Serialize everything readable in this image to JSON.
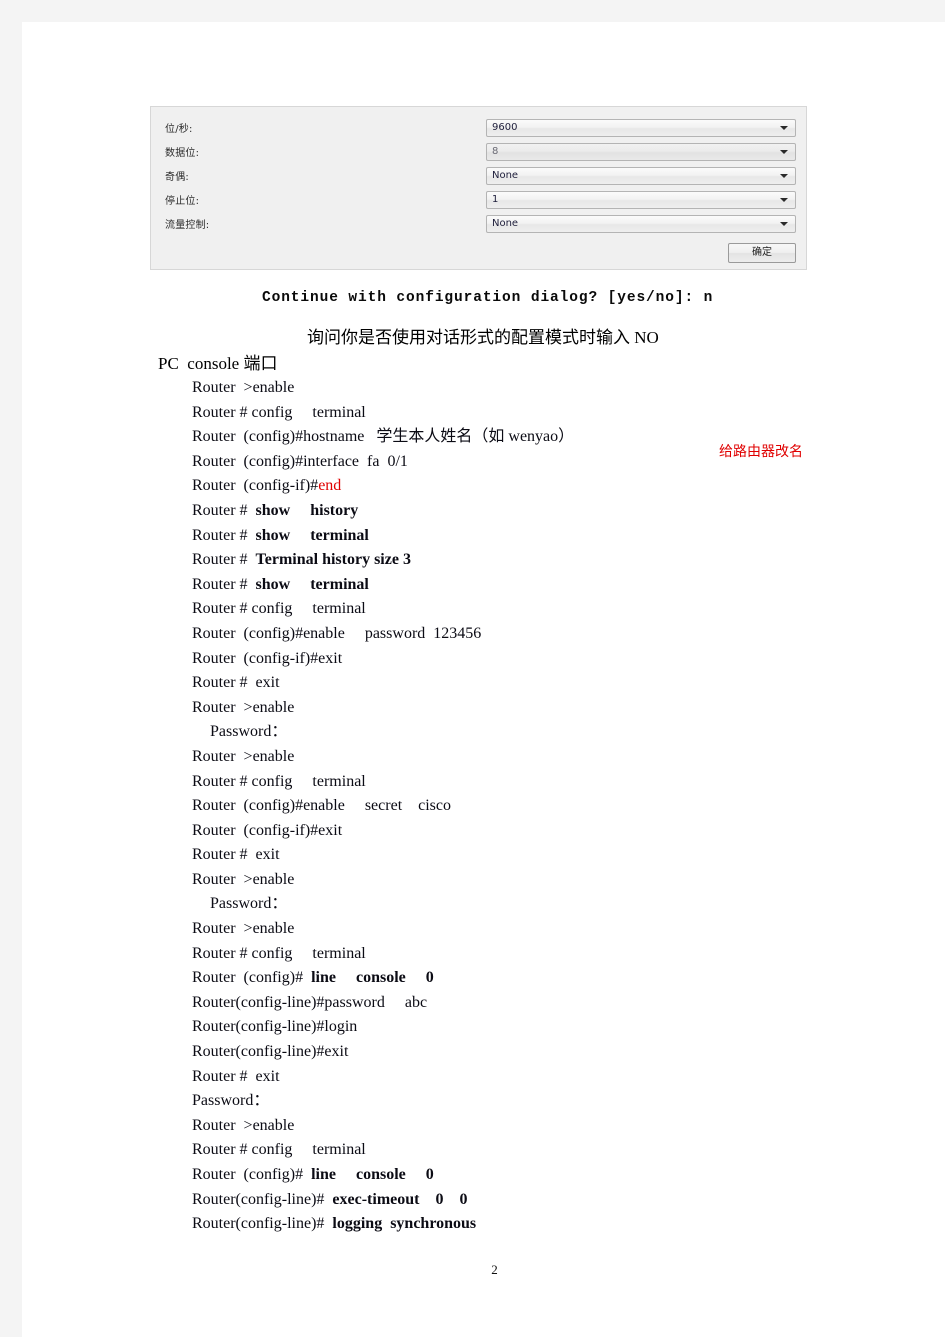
{
  "dialog": {
    "rows": [
      {
        "label": "位/秒:",
        "value": "9600",
        "dim": false
      },
      {
        "label": "数据位:",
        "value": "8",
        "dim": true
      },
      {
        "label": "奇偶:",
        "value": "None",
        "dim": false
      },
      {
        "label": "停止位:",
        "value": "1",
        "dim": false
      },
      {
        "label": "流量控制:",
        "value": "None",
        "dim": false
      }
    ],
    "ok_label": "确定"
  },
  "console_prompt": "Continue with configuration dialog? [yes/no]: n",
  "caption_cn": "询问你是否使用对话形式的配置模式时输入 NO",
  "section_head": "PC  console 端口",
  "red_note": "给路由器改名",
  "page_number": "2",
  "commands": [
    {
      "indent": 0,
      "parts": [
        {
          "t": "Router  >enable",
          "b": false,
          "r": false
        }
      ]
    },
    {
      "indent": 0,
      "parts": [
        {
          "t": "Router # config     terminal",
          "b": false,
          "r": false
        }
      ]
    },
    {
      "indent": 0,
      "parts": [
        {
          "t": "Router  (config)#hostname   学生本人姓名（如 wenyao）",
          "b": false,
          "r": false
        }
      ]
    },
    {
      "indent": 0,
      "parts": [
        {
          "t": "Router  (config)#interface  fa  0/1",
          "b": false,
          "r": false
        }
      ]
    },
    {
      "indent": 0,
      "parts": [
        {
          "t": "Router  (config-if)#",
          "b": false,
          "r": false
        },
        {
          "t": "end",
          "b": false,
          "r": true
        }
      ]
    },
    {
      "indent": 0,
      "parts": [
        {
          "t": "Router #  ",
          "b": false,
          "r": false
        },
        {
          "t": "show     history",
          "b": true,
          "r": false
        }
      ]
    },
    {
      "indent": 0,
      "parts": [
        {
          "t": "Router #  ",
          "b": false,
          "r": false
        },
        {
          "t": "show     terminal",
          "b": true,
          "r": false
        }
      ]
    },
    {
      "indent": 0,
      "parts": [
        {
          "t": "Router #  ",
          "b": false,
          "r": false
        },
        {
          "t": "Terminal history size 3",
          "b": true,
          "r": false
        }
      ]
    },
    {
      "indent": 0,
      "parts": [
        {
          "t": "Router #  ",
          "b": false,
          "r": false
        },
        {
          "t": "show     terminal",
          "b": true,
          "r": false
        }
      ]
    },
    {
      "indent": 0,
      "parts": [
        {
          "t": "Router # config     terminal",
          "b": false,
          "r": false
        }
      ]
    },
    {
      "indent": 0,
      "parts": [
        {
          "t": "Router  (config)#enable     password  123456",
          "b": false,
          "r": false
        }
      ]
    },
    {
      "indent": 0,
      "parts": [
        {
          "t": "Router  (config-if)#exit",
          "b": false,
          "r": false
        }
      ]
    },
    {
      "indent": 0,
      "parts": [
        {
          "t": "Router #  exit",
          "b": false,
          "r": false
        }
      ]
    },
    {
      "indent": 0,
      "parts": [
        {
          "t": "Router  >enable",
          "b": false,
          "r": false
        }
      ]
    },
    {
      "indent": 1,
      "parts": [
        {
          "t": "Password：",
          "b": false,
          "r": false
        }
      ]
    },
    {
      "indent": 0,
      "parts": [
        {
          "t": "Router  >enable",
          "b": false,
          "r": false
        }
      ]
    },
    {
      "indent": 0,
      "parts": [
        {
          "t": "Router # config     terminal",
          "b": false,
          "r": false
        }
      ]
    },
    {
      "indent": 0,
      "parts": [
        {
          "t": "Router  (config)#enable     secret    cisco",
          "b": false,
          "r": false
        }
      ]
    },
    {
      "indent": 0,
      "parts": [
        {
          "t": "Router  (config-if)#exit",
          "b": false,
          "r": false
        }
      ]
    },
    {
      "indent": 0,
      "parts": [
        {
          "t": "Router #  exit",
          "b": false,
          "r": false
        }
      ]
    },
    {
      "indent": 0,
      "parts": [
        {
          "t": "Router  >enable",
          "b": false,
          "r": false
        }
      ]
    },
    {
      "indent": 1,
      "parts": [
        {
          "t": "Password：",
          "b": false,
          "r": false
        }
      ]
    },
    {
      "indent": 0,
      "parts": [
        {
          "t": "Router  >enable",
          "b": false,
          "r": false
        }
      ]
    },
    {
      "indent": 0,
      "parts": [
        {
          "t": "Router # config     terminal",
          "b": false,
          "r": false
        }
      ]
    },
    {
      "indent": 0,
      "parts": [
        {
          "t": "Router  (config)#  ",
          "b": false,
          "r": false
        },
        {
          "t": "line     console     0",
          "b": true,
          "r": false
        }
      ]
    },
    {
      "indent": 0,
      "parts": [
        {
          "t": "Router(config-line)#password     abc",
          "b": false,
          "r": false
        }
      ]
    },
    {
      "indent": 0,
      "parts": [
        {
          "t": "Router(config-line)#login",
          "b": false,
          "r": false
        }
      ]
    },
    {
      "indent": 0,
      "parts": [
        {
          "t": "Router(config-line)#exit",
          "b": false,
          "r": false
        }
      ]
    },
    {
      "indent": 0,
      "parts": [
        {
          "t": "Router #  exit",
          "b": false,
          "r": false
        }
      ]
    },
    {
      "indent": 0,
      "parts": [
        {
          "t": "Password：",
          "b": false,
          "r": false
        }
      ]
    },
    {
      "indent": 0,
      "parts": [
        {
          "t": "Router  >enable",
          "b": false,
          "r": false
        }
      ]
    },
    {
      "indent": 0,
      "parts": [
        {
          "t": "Router # config     terminal",
          "b": false,
          "r": false
        }
      ]
    },
    {
      "indent": 0,
      "parts": [
        {
          "t": "Router  (config)#  ",
          "b": false,
          "r": false
        },
        {
          "t": "line     console     0",
          "b": true,
          "r": false
        }
      ]
    },
    {
      "indent": 0,
      "parts": [
        {
          "t": "Router(config-line)#  ",
          "b": false,
          "r": false
        },
        {
          "t": "exec-timeout    0    0",
          "b": true,
          "r": false
        }
      ]
    },
    {
      "indent": 0,
      "parts": [
        {
          "t": "Router(config-line)#  ",
          "b": false,
          "r": false
        },
        {
          "t": "logging  synchronous",
          "b": true,
          "r": false
        }
      ]
    }
  ]
}
